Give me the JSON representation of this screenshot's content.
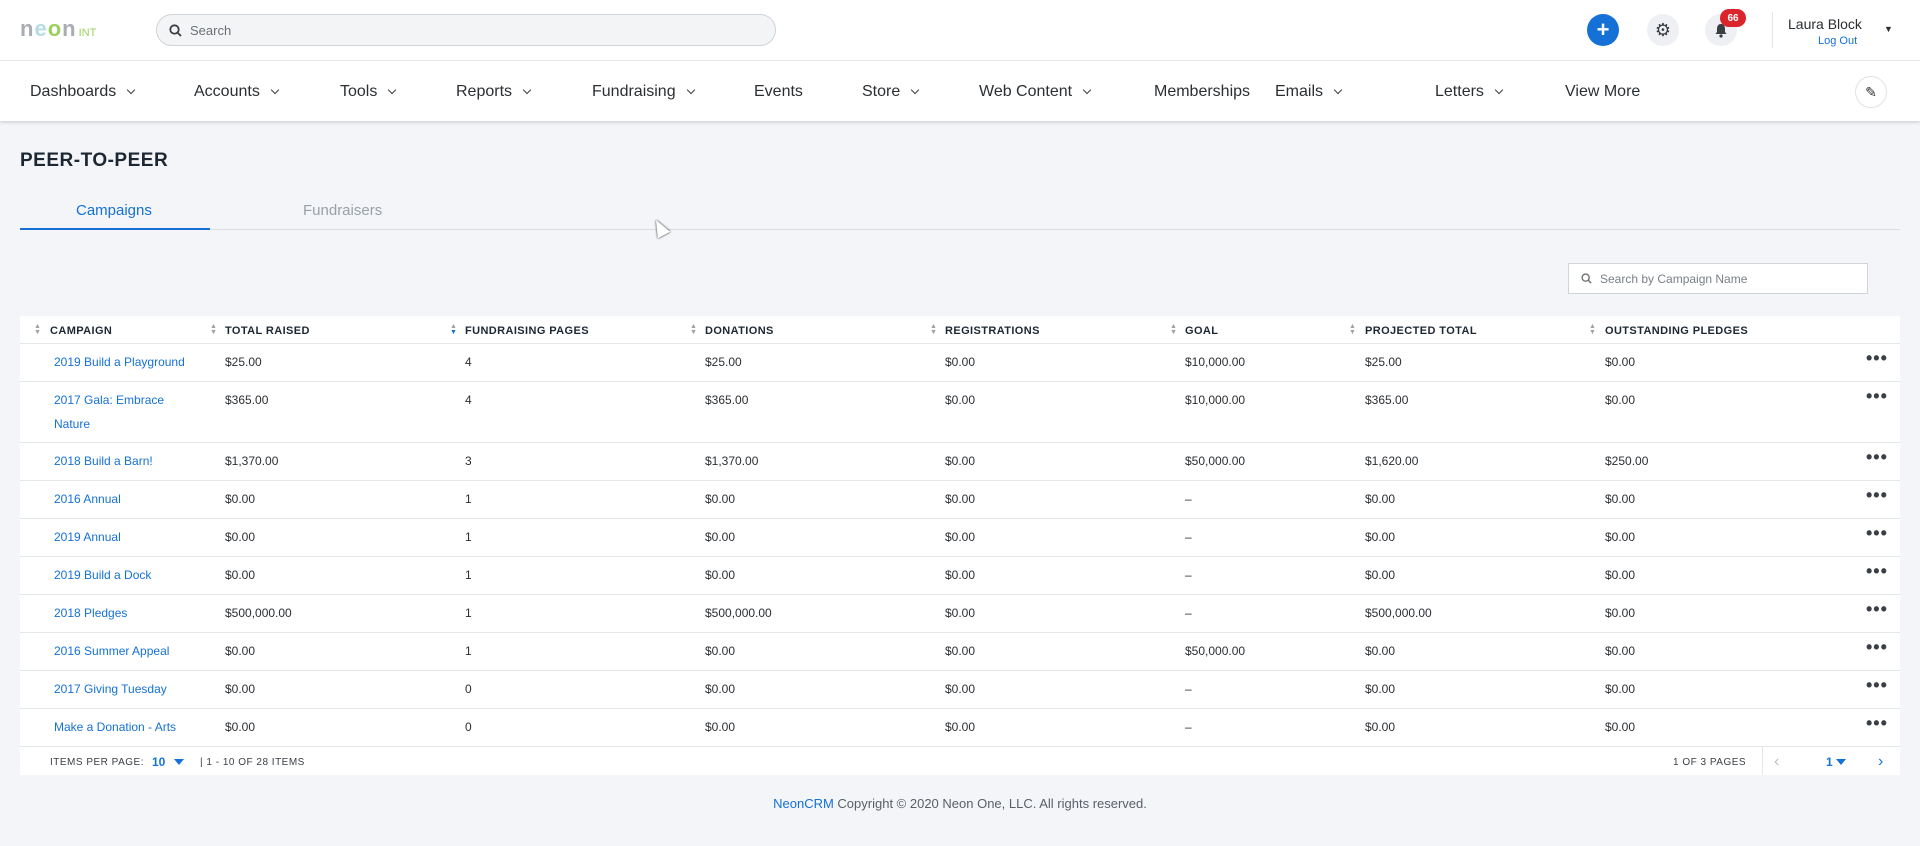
{
  "header": {
    "logo_letters": [
      "n",
      "e",
      "o",
      "n"
    ],
    "logo_suffix": "INT",
    "search_placeholder": "Search",
    "notification_count": "66",
    "user_name": "Laura Block",
    "logout_label": "Log Out"
  },
  "nav": {
    "items": [
      {
        "label": "Dashboards",
        "dropdown": true
      },
      {
        "label": "Accounts",
        "dropdown": true
      },
      {
        "label": "Tools",
        "dropdown": true
      },
      {
        "label": "Reports",
        "dropdown": true
      },
      {
        "label": "Fundraising",
        "dropdown": true
      },
      {
        "label": "Events",
        "dropdown": false
      },
      {
        "label": "Store",
        "dropdown": true
      },
      {
        "label": "Web Content",
        "dropdown": true
      },
      {
        "label": "Memberships",
        "dropdown": false
      },
      {
        "label": "Emails",
        "dropdown": true
      },
      {
        "label": "Letters",
        "dropdown": true
      },
      {
        "label": "View More",
        "dropdown": false
      }
    ]
  },
  "page": {
    "title": "PEER-TO-PEER",
    "tabs": [
      {
        "label": "Campaigns",
        "active": true
      },
      {
        "label": "Fundraisers",
        "active": false
      }
    ],
    "campaign_search_placeholder": "Search by Campaign Name"
  },
  "table": {
    "columns": [
      "CAMPAIGN",
      "TOTAL RAISED",
      "FUNDRAISING PAGES",
      "DONATIONS",
      "REGISTRATIONS",
      "GOAL",
      "PROJECTED TOTAL",
      "OUTSTANDING PLEDGES"
    ],
    "sorted_column": "FUNDRAISING PAGES",
    "sort_direction": "descending",
    "rows": [
      {
        "campaign": "2019 Build a Playground",
        "total_raised": "$25.00",
        "pages": "4",
        "donations": "$25.00",
        "registrations": "$0.00",
        "goal": "$10,000.00",
        "projected": "$25.00",
        "pledges": "$0.00"
      },
      {
        "campaign": "2017 Gala: Embrace Nature",
        "total_raised": "$365.00",
        "pages": "4",
        "donations": "$365.00",
        "registrations": "$0.00",
        "goal": "$10,000.00",
        "projected": "$365.00",
        "pledges": "$0.00"
      },
      {
        "campaign": "2018 Build a Barn!",
        "total_raised": "$1,370.00",
        "pages": "3",
        "donations": "$1,370.00",
        "registrations": "$0.00",
        "goal": "$50,000.00",
        "projected": "$1,620.00",
        "pledges": "$250.00"
      },
      {
        "campaign": "2016 Annual",
        "total_raised": "$0.00",
        "pages": "1",
        "donations": "$0.00",
        "registrations": "$0.00",
        "goal": "–",
        "projected": "$0.00",
        "pledges": "$0.00"
      },
      {
        "campaign": "2019 Annual",
        "total_raised": "$0.00",
        "pages": "1",
        "donations": "$0.00",
        "registrations": "$0.00",
        "goal": "–",
        "projected": "$0.00",
        "pledges": "$0.00"
      },
      {
        "campaign": "2019 Build a Dock",
        "total_raised": "$0.00",
        "pages": "1",
        "donations": "$0.00",
        "registrations": "$0.00",
        "goal": "–",
        "projected": "$0.00",
        "pledges": "$0.00"
      },
      {
        "campaign": "2018 Pledges",
        "total_raised": "$500,000.00",
        "pages": "1",
        "donations": "$500,000.00",
        "registrations": "$0.00",
        "goal": "–",
        "projected": "$500,000.00",
        "pledges": "$0.00"
      },
      {
        "campaign": "2016 Summer Appeal",
        "total_raised": "$0.00",
        "pages": "1",
        "donations": "$0.00",
        "registrations": "$0.00",
        "goal": "$50,000.00",
        "projected": "$0.00",
        "pledges": "$0.00"
      },
      {
        "campaign": "2017 Giving Tuesday",
        "total_raised": "$0.00",
        "pages": "0",
        "donations": "$0.00",
        "registrations": "$0.00",
        "goal": "–",
        "projected": "$0.00",
        "pledges": "$0.00"
      },
      {
        "campaign": "Make a Donation - Arts",
        "total_raised": "$0.00",
        "pages": "0",
        "donations": "$0.00",
        "registrations": "$0.00",
        "goal": "–",
        "projected": "$0.00",
        "pledges": "$0.00"
      }
    ],
    "row_action_label": "•••"
  },
  "pagination": {
    "items_per_page_label": "ITEMS PER PAGE:",
    "items_per_page": "10",
    "range_label": "| 1 - 10 OF 28 ITEMS",
    "pages_label": "1 OF 3 PAGES",
    "current_page": "1",
    "prev_label": "‹",
    "next_label": "›"
  },
  "footer": {
    "brand": "NeonCRM",
    "copyright": "Copyright © 2020 Neon One, LLC. All rights reserved."
  },
  "colors": {
    "accent": "#1571d5",
    "badge": "#d9252b",
    "page_bg": "#f3f5f8"
  },
  "icons": [
    "search-icon",
    "plus-icon",
    "gear-icon",
    "bell-icon",
    "caret-down-icon",
    "pencil-icon",
    "sort-icon",
    "more-icon",
    "chevron-left-icon",
    "chevron-right-icon",
    "mouse-cursor"
  ]
}
